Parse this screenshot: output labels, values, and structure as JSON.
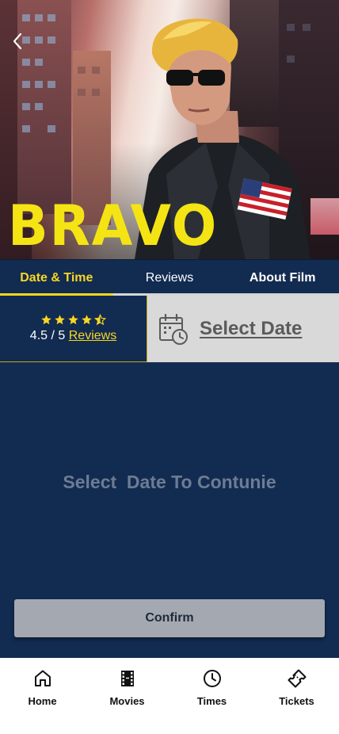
{
  "poster": {
    "title": "BRAVO"
  },
  "tabs": [
    {
      "label": "Date & Time",
      "active": true
    },
    {
      "label": "Reviews",
      "active": false
    },
    {
      "label": "About Film",
      "active": false
    }
  ],
  "rating": {
    "stars": 4.5,
    "score_text": "4.5 / 5",
    "reviews_link": "Reviews"
  },
  "select_date": {
    "label": "Select Date",
    "icon": "calendar-clock-icon"
  },
  "main": {
    "empty_message": "Select  Date To Contunie",
    "confirm_label": "Confirm"
  },
  "bottom_nav": [
    {
      "label": "Home",
      "icon": "home-icon"
    },
    {
      "label": "Movies",
      "icon": "film-icon"
    },
    {
      "label": "Times",
      "icon": "clock-icon"
    },
    {
      "label": "Tickets",
      "icon": "ticket-icon"
    }
  ],
  "colors": {
    "navy": "#122b51",
    "accent_yellow": "#f8d623",
    "poster_title": "#f5e414",
    "select_date_bg": "#d9d9d9",
    "confirm_bg": "#a4a9b1"
  }
}
